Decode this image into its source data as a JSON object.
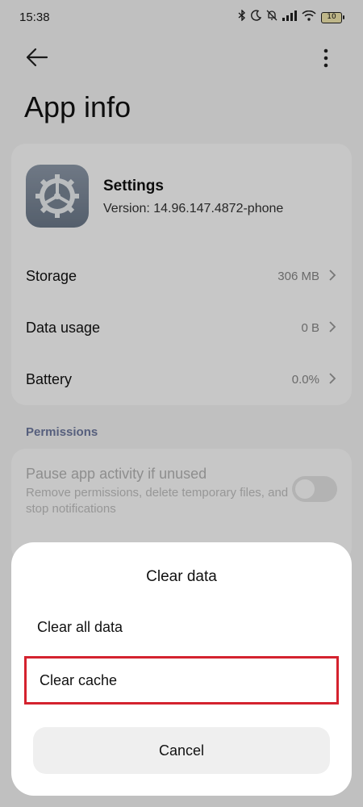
{
  "status": {
    "time": "15:38",
    "battery": "10",
    "icons": [
      "bluetooth-icon",
      "moon-icon",
      "bell-off-icon",
      "signal-icon",
      "wifi-icon",
      "battery-icon"
    ]
  },
  "header": {
    "title": "App info"
  },
  "app": {
    "name": "Settings",
    "version": "Version: 14.96.147.4872-phone"
  },
  "rows": [
    {
      "label": "Storage",
      "value": "306 MB"
    },
    {
      "label": "Data usage",
      "value": "0 B"
    },
    {
      "label": "Battery",
      "value": "0.0%"
    }
  ],
  "permissions": {
    "section_label": "Permissions",
    "title": "Pause app activity if unused",
    "description": "Remove permissions, delete temporary files, and stop notifications",
    "toggle_on": false
  },
  "dialog": {
    "title": "Clear data",
    "options": [
      "Clear all data",
      "Clear cache"
    ],
    "highlight_color": "#d4222e",
    "cancel": "Cancel"
  }
}
